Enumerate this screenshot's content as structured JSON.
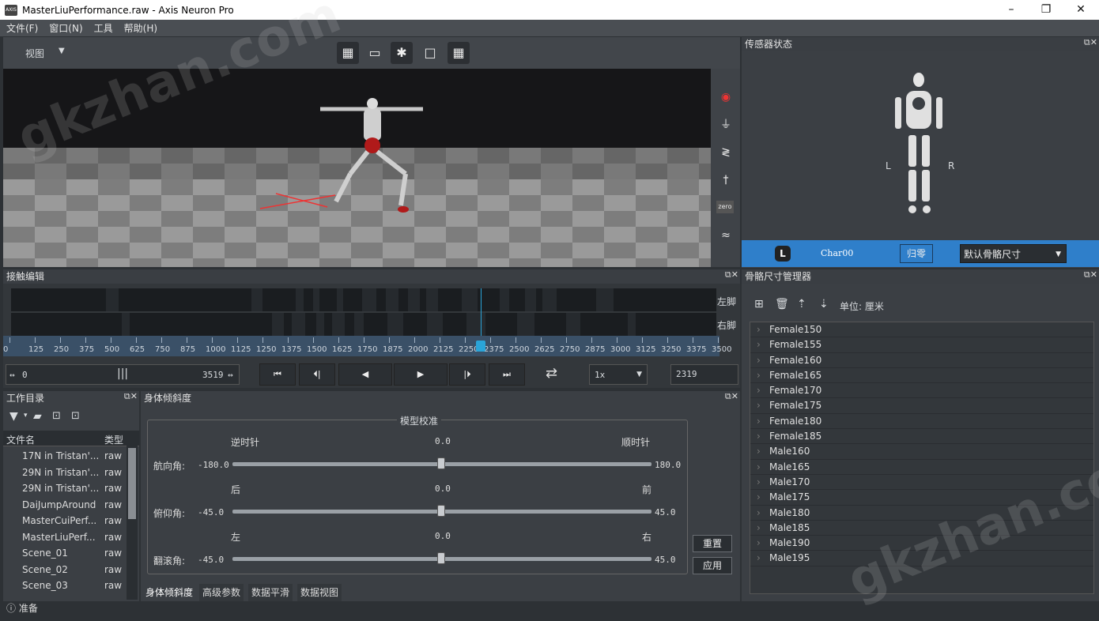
{
  "window": {
    "title": "MasterLiuPerformance.raw - Axis Neuron Pro",
    "app_icon": "AXIS",
    "minimize": "–",
    "restore": "❐",
    "close": "✕"
  },
  "menu": [
    "文件(F)",
    "窗口(N)",
    "工具",
    "帮助(H)"
  ],
  "viewport": {
    "view_label": "视图",
    "toolbar_icons": [
      "checker-icon",
      "camera-icon",
      "figure-icon",
      "square-icon",
      "checker2-icon"
    ],
    "side_icons": [
      "record-icon",
      "plug-icon",
      "calibrate-icon",
      "tpose-icon",
      "zero-icon",
      "wave-icon"
    ],
    "zero_text": "zero"
  },
  "sensor": {
    "title": "传感器状态",
    "left": "L",
    "right": "R",
    "badge": "L",
    "char_name": "Char00",
    "reset_btn": "归零",
    "size_select": "默认骨骼尺寸"
  },
  "contact": {
    "title": "接触编辑",
    "left_foot": "左脚",
    "right_foot": "右脚",
    "ticks": [
      "0",
      "125",
      "250",
      "375",
      "500",
      "625",
      "750",
      "875",
      "1000",
      "1125",
      "1250",
      "1375",
      "1500",
      "1625",
      "1750",
      "1875",
      "2000",
      "2125",
      "2250",
      "2375",
      "2500",
      "2625",
      "2750",
      "2875",
      "3000",
      "3125",
      "3250",
      "3375",
      "3500"
    ],
    "range_start": "0",
    "range_end": "3519",
    "speed": "1x",
    "frame": "2319",
    "current_frame": 2319,
    "max_frame": 3500
  },
  "bone": {
    "title": "骨骼尺寸管理器",
    "unit": "单位: 厘米",
    "items": [
      "Female150",
      "Female155",
      "Female160",
      "Female165",
      "Female170",
      "Female175",
      "Female180",
      "Female185",
      "Male160",
      "Male165",
      "Male170",
      "Male175",
      "Male180",
      "Male185",
      "Male190",
      "Male195"
    ]
  },
  "workdir": {
    "title": "工作目录",
    "col_name": "文件名",
    "col_type": "类型",
    "files": [
      {
        "name": "17N in Tristan'...",
        "type": "raw"
      },
      {
        "name": "29N in Tristan'...",
        "type": "raw"
      },
      {
        "name": "29N in Tristan'...",
        "type": "raw"
      },
      {
        "name": "DaiJumpAround",
        "type": "raw"
      },
      {
        "name": "MasterCuiPerf...",
        "type": "raw"
      },
      {
        "name": "MasterLiuPerf...",
        "type": "raw"
      },
      {
        "name": "Scene_01",
        "type": "raw"
      },
      {
        "name": "Scene_02",
        "type": "raw"
      },
      {
        "name": "Scene_03",
        "type": "raw"
      }
    ]
  },
  "tilt": {
    "title": "身体倾斜度",
    "group": "模型校准",
    "yaw": {
      "label": "航向角:",
      "min": "-180.0",
      "max": "180.0",
      "value": "0.0",
      "left": "逆时针",
      "right": "顺时针"
    },
    "pitch": {
      "label": "俯仰角:",
      "min": "-45.0",
      "max": "45.0",
      "value": "0.0",
      "left": "后",
      "right": "前"
    },
    "roll": {
      "label": "翻滚角:",
      "min": "-45.0",
      "max": "45.0",
      "value": "0.0",
      "left": "左",
      "right": "右"
    },
    "reset": "重置",
    "apply": "应用",
    "tabs": [
      "身体倾斜度",
      "高级参数",
      "数据平滑",
      "数据视图"
    ]
  },
  "status": "准备",
  "watermark": "gkzhan.com"
}
